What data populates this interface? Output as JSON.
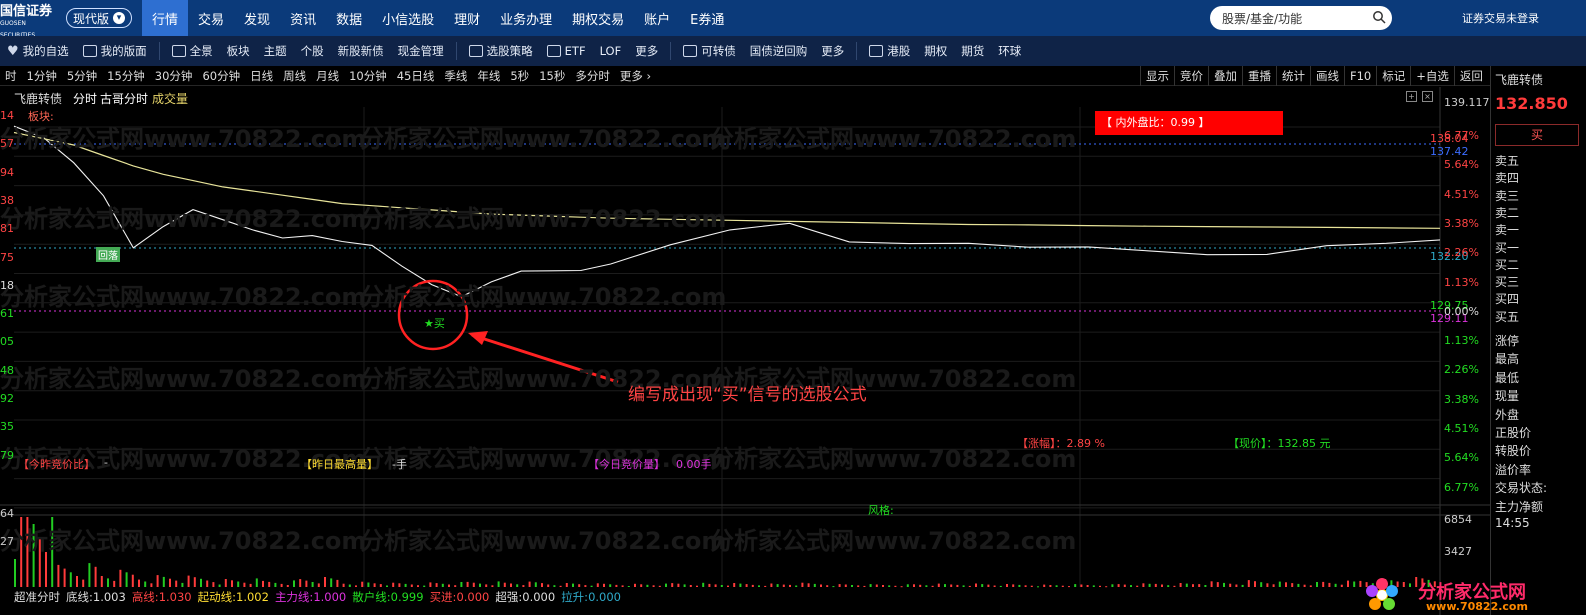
{
  "nav": {
    "logo": "国信证券",
    "logo_sub": "GUOSEN SECURITIES",
    "version": "现代版",
    "menu": [
      "行情",
      "交易",
      "发现",
      "资讯",
      "数据",
      "小信选股",
      "理财",
      "业务办理",
      "期权交易",
      "账户",
      "E券通"
    ],
    "active": "行情",
    "search_placeholder": "股票/基金/功能",
    "login_status": "证券交易未登录"
  },
  "subbar": {
    "items": [
      "我的自选",
      "我的版面",
      "全景",
      "板块",
      "主题",
      "个股",
      "新股新债",
      "现金管理",
      "选股策略",
      "ETF",
      "LOF",
      "更多",
      "可转债",
      "国债逆回购",
      "更多",
      "港股",
      "期权",
      "期货",
      "环球"
    ]
  },
  "periods": [
    "时",
    "1分钟",
    "5分钟",
    "15分钟",
    "30分钟",
    "60分钟",
    "日线",
    "周线",
    "月线",
    "10分钟",
    "45日线",
    "季线",
    "年线",
    "5秒",
    "15秒",
    "多分时",
    "更多 ›"
  ],
  "tool_buttons": [
    "显示",
    "竞价",
    "叠加",
    "重播",
    "统计",
    "画线",
    "F10",
    "标记",
    "+自选",
    "返回"
  ],
  "chart_header": {
    "stock_name": "飞鹿转债",
    "tab_fenshi": "分时",
    "tab_guge": "古哥分时",
    "tab_volume": "成交量",
    "sector_label": "板块:",
    "top_price": "139.117"
  },
  "badges": {
    "neiwai": "【 内外盘比：0.99 】",
    "huiluo": "回落",
    "buy_signal": "★买"
  },
  "right_axis_prices": [
    {
      "label": "138.04",
      "color": "#ff4444"
    },
    {
      "label": "137.42",
      "color": "#3b6cff"
    },
    {
      "label": "132.20",
      "color": "#2fa9c8"
    },
    {
      "label": "129.75",
      "color": "#22dd22"
    },
    {
      "label": "129.11",
      "color": "#dd33dd"
    }
  ],
  "pct_axis": [
    {
      "label": "6.77%",
      "color": "#ff4444"
    },
    {
      "label": "5.64%",
      "color": "#ff4444"
    },
    {
      "label": "4.51%",
      "color": "#ff4444"
    },
    {
      "label": "3.38%",
      "color": "#ff4444"
    },
    {
      "label": "2.26%",
      "color": "#ff4444"
    },
    {
      "label": "1.13%",
      "color": "#ff4444"
    },
    {
      "label": "0.00%",
      "color": "#dddddd"
    },
    {
      "label": "1.13%",
      "color": "#22dd22"
    },
    {
      "label": "2.26%",
      "color": "#22dd22"
    },
    {
      "label": "3.38%",
      "color": "#22dd22"
    },
    {
      "label": "4.51%",
      "color": "#22dd22"
    },
    {
      "label": "5.64%",
      "color": "#22dd22"
    },
    {
      "label": "6.77%",
      "color": "#22dd22"
    }
  ],
  "left_axis": [
    "14",
    "57",
    "94",
    "38",
    "81",
    "75",
    "18",
    "61",
    "05",
    "48",
    "92",
    "35",
    "79",
    "64",
    "27"
  ],
  "info_row": {
    "zhangfu": "【涨幅】：2.89 %",
    "xianjia": "【现价】：132.85 元",
    "jinzuo_label": "【今昨竞价比】",
    "jinzuo_val": "-",
    "zuori_label": "【昨日最高量】",
    "zuori_val": "-手",
    "jinri_label": "【今日竞价量】",
    "jinri_val": "0.00手",
    "fengge": "风格:"
  },
  "volume": {
    "max": "6854",
    "mid": "3427"
  },
  "bottom_line": [
    {
      "label": "超准分时",
      "value": "",
      "color": "#dddddd"
    },
    {
      "label": "底线:",
      "value": "1.003",
      "color": "#dddddd"
    },
    {
      "label": "高线:",
      "value": "1.030",
      "color": "#ff4444"
    },
    {
      "label": "起动线:",
      "value": "1.002",
      "color": "#ffdd33"
    },
    {
      "label": "主力线:",
      "value": "1.000",
      "color": "#dd33dd"
    },
    {
      "label": "散户线:",
      "value": "0.999",
      "color": "#22dd22"
    },
    {
      "label": "买进:",
      "value": "0.000",
      "color": "#ff4444"
    },
    {
      "label": "超强:",
      "value": "0.000",
      "color": "#dddddd"
    },
    {
      "label": "拉升:",
      "value": "0.000",
      "color": "#2fa9c8"
    }
  ],
  "annotation": "编写成出现“买”信号的选股公式",
  "right_panel": {
    "name": "飞鹿转债",
    "price": "132.850",
    "buy_button": "买",
    "order_book": [
      "卖五",
      "卖四",
      "卖三",
      "卖二",
      "卖一",
      "买一",
      "买二",
      "买三",
      "买四",
      "买五"
    ],
    "stats": [
      "涨停",
      "最高",
      "最低",
      "现量",
      "外盘",
      "正股价",
      "转股价",
      "溢价率",
      "交易状态:",
      "主力净额",
      "14:55"
    ]
  },
  "watermark": {
    "center": "分析家公式网www.70822.com",
    "brand": "分析家公式网",
    "url": "www.70822.com"
  },
  "chart_data": {
    "type": "line",
    "title": "飞鹿转债 分时",
    "x": [
      0,
      5,
      10,
      15,
      20,
      25,
      30,
      35,
      40,
      45,
      50,
      55,
      60,
      65,
      70,
      75,
      80,
      85,
      90,
      95,
      100,
      110,
      120,
      130,
      140,
      150,
      160,
      170,
      180,
      190,
      200,
      210,
      220,
      230,
      239
    ],
    "series": [
      {
        "name": "价格",
        "values": [
          138.2,
          137.6,
          136.5,
          135.0,
          132.3,
          133.4,
          134.3,
          133.6,
          133.2,
          132.9,
          133.1,
          132.6,
          132.5,
          131.6,
          130.5,
          130.0,
          130.8,
          131.4,
          131.2,
          131.3,
          131.7,
          132.4,
          133.2,
          133.6,
          132.8,
          132.5,
          132.6,
          132.5,
          132.3,
          132.2,
          132.1,
          132.2,
          132.4,
          132.6,
          132.85
        ]
      },
      {
        "name": "均价",
        "values": [
          137.9,
          137.6,
          137.3,
          136.8,
          136.3,
          135.9,
          135.6,
          135.3,
          135.1,
          134.9,
          134.7,
          134.5,
          134.4,
          134.3,
          134.2,
          134.1,
          134.0,
          133.95,
          133.9,
          133.85,
          133.8,
          133.75,
          133.7,
          133.65,
          133.6,
          133.55,
          133.5,
          133.48,
          133.45,
          133.42,
          133.4,
          133.38,
          133.36,
          133.34,
          133.32
        ]
      }
    ],
    "ylim": [
      120.38,
      139.117
    ],
    "reference_price": 129.11,
    "buy_signal_x": 71,
    "volume": [
      6854,
      1800,
      1200,
      900,
      800,
      600,
      500,
      700,
      400,
      300,
      350,
      420,
      380,
      300,
      260,
      240,
      320,
      280,
      260,
      300,
      220,
      200,
      240,
      260,
      210,
      180,
      200,
      260,
      300,
      400,
      520,
      380,
      450,
      600,
      700
    ]
  }
}
